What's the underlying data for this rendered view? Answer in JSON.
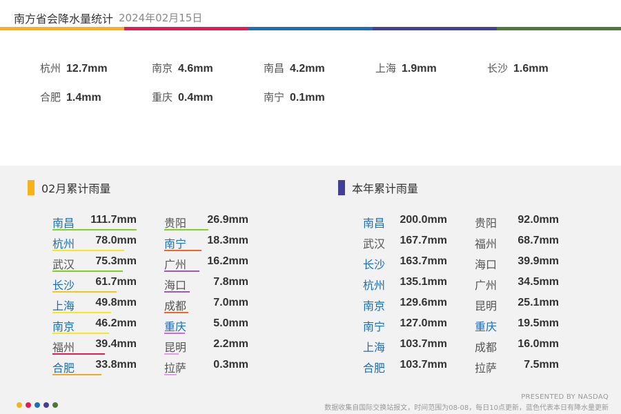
{
  "header": {
    "title": "南方省会降水量统计",
    "date": "2024年02月15日",
    "stripe_colors": [
      "#f5b21b",
      "#e8194f",
      "#1a6fb5",
      "#433f96",
      "#4a7a35"
    ]
  },
  "today": [
    {
      "city": "杭州",
      "value": "12.7mm"
    },
    {
      "city": "南京",
      "value": "4.6mm"
    },
    {
      "city": "南昌",
      "value": "4.2mm"
    },
    {
      "city": "上海",
      "value": "1.9mm"
    },
    {
      "city": "长沙",
      "value": "1.6mm"
    },
    {
      "city": "合肥",
      "value": "1.4mm"
    },
    {
      "city": "重庆",
      "value": "0.4mm"
    },
    {
      "city": "南宁",
      "value": "0.1mm"
    }
  ],
  "monthly": {
    "title": "02月累计雨量",
    "marker_color": "#f5b21b",
    "rows": [
      {
        "city": "南昌",
        "value": "111.7mm",
        "amount": 111.7,
        "color": "#7ed321",
        "city_color": "blue"
      },
      {
        "city": "杭州",
        "value": "78.0mm",
        "amount": 78.0,
        "color": "#f8e71c",
        "city_color": "blue"
      },
      {
        "city": "武汉",
        "value": "75.3mm",
        "amount": 75.3,
        "color": "#7ed321",
        "city_color": "grey"
      },
      {
        "city": "长沙",
        "value": "61.7mm",
        "amount": 61.7,
        "color": "#f5c518",
        "city_color": "blue"
      },
      {
        "city": "上海",
        "value": "49.8mm",
        "amount": 49.8,
        "color": "#f8e71c",
        "city_color": "blue"
      },
      {
        "city": "南京",
        "value": "46.2mm",
        "amount": 46.2,
        "color": "#f8e71c",
        "city_color": "blue"
      },
      {
        "city": "福州",
        "value": "39.4mm",
        "amount": 39.4,
        "color": "#e8194f",
        "city_color": "grey"
      },
      {
        "city": "合肥",
        "value": "33.8mm",
        "amount": 33.8,
        "color": "#f5a623",
        "city_color": "blue"
      },
      {
        "city": "贵阳",
        "value": "26.9mm",
        "amount": 26.9,
        "color": "#7ed321",
        "city_color": "grey"
      },
      {
        "city": "南宁",
        "value": "18.3mm",
        "amount": 18.3,
        "color": "#f26522",
        "city_color": "blue"
      },
      {
        "city": "广州",
        "value": "16.2mm",
        "amount": 16.2,
        "color": "#9b59b6",
        "city_color": "grey"
      },
      {
        "city": "海口",
        "value": "7.8mm",
        "amount": 7.8,
        "color": "#9b59b6",
        "city_color": "grey"
      },
      {
        "city": "成都",
        "value": "7.0mm",
        "amount": 7.0,
        "color": "#f26522",
        "city_color": "grey"
      },
      {
        "city": "重庆",
        "value": "5.0mm",
        "amount": 5.0,
        "color": "#c86dd7",
        "city_color": "blue"
      },
      {
        "city": "昆明",
        "value": "2.2mm",
        "amount": 2.2,
        "color": "#e59be8",
        "city_color": "grey"
      },
      {
        "city": "拉萨",
        "value": "0.3mm",
        "amount": 0.3,
        "color": "#e59be8",
        "city_color": "grey"
      }
    ]
  },
  "yearly": {
    "title": "本年累计雨量",
    "marker_color": "#433f96",
    "rows": [
      {
        "city": "南昌",
        "value": "200.0mm",
        "city_color": "blue"
      },
      {
        "city": "武汉",
        "value": "167.7mm",
        "city_color": "grey"
      },
      {
        "city": "长沙",
        "value": "163.7mm",
        "city_color": "blue"
      },
      {
        "city": "杭州",
        "value": "135.1mm",
        "city_color": "blue"
      },
      {
        "city": "南京",
        "value": "129.6mm",
        "city_color": "blue"
      },
      {
        "city": "南宁",
        "value": "127.0mm",
        "city_color": "blue"
      },
      {
        "city": "上海",
        "value": "103.7mm",
        "city_color": "blue"
      },
      {
        "city": "合肥",
        "value": "103.7mm",
        "city_color": "blue"
      },
      {
        "city": "贵阳",
        "value": "92.0mm",
        "city_color": "grey"
      },
      {
        "city": "福州",
        "value": "68.7mm",
        "city_color": "grey"
      },
      {
        "city": "海口",
        "value": "39.9mm",
        "city_color": "grey"
      },
      {
        "city": "广州",
        "value": "34.5mm",
        "city_color": "grey"
      },
      {
        "city": "昆明",
        "value": "25.1mm",
        "city_color": "grey"
      },
      {
        "city": "重庆",
        "value": "19.5mm",
        "city_color": "blue"
      },
      {
        "city": "成都",
        "value": "16.0mm",
        "city_color": "grey"
      },
      {
        "city": "拉萨",
        "value": "7.5mm",
        "city_color": "grey"
      }
    ]
  },
  "footer": {
    "dot_colors": [
      "#f5b21b",
      "#e8194f",
      "#1a6fb5",
      "#433f96",
      "#4a7a35"
    ],
    "presented": "PRESENTED BY NASDAQ",
    "note": "数据收集自国际交换站报文，时间范围为08-08，每日10点更新，蓝色代表本日有降水量更新"
  }
}
